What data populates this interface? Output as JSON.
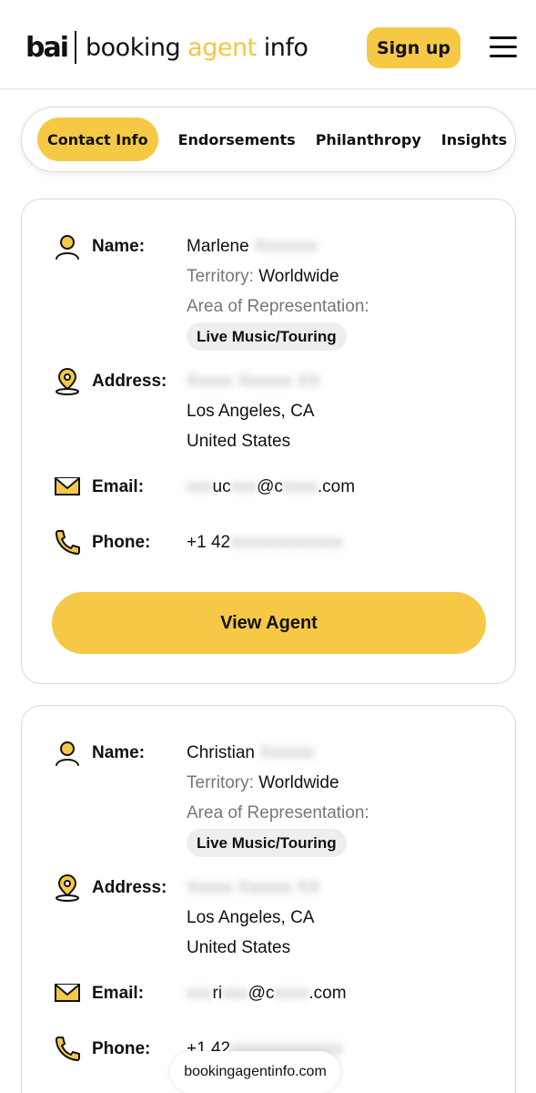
{
  "header": {
    "logo_mark": "bai",
    "logo_word1": "booking ",
    "logo_word2": "agent",
    "logo_word3": " info",
    "signup_label": "Sign up",
    "menu_icon": "hamburger-icon"
  },
  "tabs": [
    {
      "label": "Contact Info",
      "active": true
    },
    {
      "label": "Endorsements",
      "active": false
    },
    {
      "label": "Philanthropy",
      "active": false
    },
    {
      "label": "Insights",
      "active": false
    }
  ],
  "labels": {
    "name": "Name:",
    "territory": "Territory:",
    "area": "Area of Representation:",
    "address": "Address:",
    "email": "Email:",
    "phone": "Phone:"
  },
  "agents": [
    {
      "first_name": "Marlene",
      "last_name_blurred": "Xxxxxxx",
      "territory": "Worldwide",
      "area": "Live Music/Touring",
      "street_blurred": "Xxxxx Xxxxxx XX",
      "city": "Los Angeles, CA",
      "country": "United States",
      "email_p1": "xxx",
      "email_p2": "uc",
      "email_p3": "xxx",
      "email_p4": "@c",
      "email_p5": "xxxx",
      "email_p6": ".com",
      "phone_prefix": "+1 42",
      "phone_blurred": "xxxxxxxxxxxxx",
      "button_label": "View Agent"
    },
    {
      "first_name": "Christian",
      "last_name_blurred": "Xxxxxx",
      "territory": "Worldwide",
      "area": "Live Music/Touring",
      "street_blurred": "Xxxxx Xxxxxx XX",
      "city": "Los Angeles, CA",
      "country": "United States",
      "email_p1": "xxx",
      "email_p2": "ri",
      "email_p3": "xxx",
      "email_p4": "@c",
      "email_p5": "xxxx",
      "email_p6": ".com",
      "phone_prefix": "+1 42",
      "phone_blurred": "xxxxxxxxxxxxx"
    }
  ],
  "footer_domain": "bookingagentinfo.com",
  "colors": {
    "accent": "#f5c945",
    "pill_bg": "#eeeeee",
    "muted_text": "#777777"
  }
}
